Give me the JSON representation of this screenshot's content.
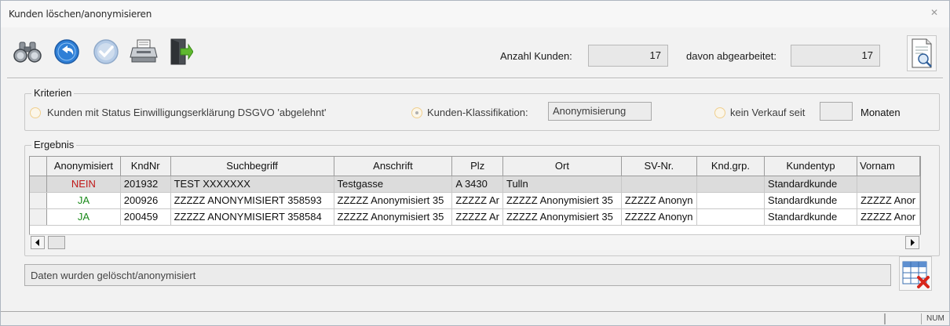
{
  "window": {
    "title": "Kunden löschen/anonymisieren"
  },
  "toolbar": {
    "buttons": [
      {
        "name": "binoculars-icon"
      },
      {
        "name": "undo-arrow-icon"
      },
      {
        "name": "checkmark-icon"
      },
      {
        "name": "printer-icon"
      },
      {
        "name": "exit-door-icon"
      }
    ],
    "count_label": "Anzahl Kunden:",
    "count_value": "17",
    "processed_label": "davon abgearbeitet:",
    "processed_value": "17",
    "preview_icon": "print-preview-icon"
  },
  "criteria": {
    "title": "Kriterien",
    "option1_label": "Kunden mit Status Einwilligungserklärung DSGVO 'abgelehnt'",
    "option2_label": "Kunden-Klassifikation:",
    "classification_value": "Anonymisierung",
    "option3_label": "kein Verkauf seit",
    "months_value": "",
    "months_unit": "Monaten",
    "selected_option": 2
  },
  "result": {
    "title": "Ergebnis",
    "columns": [
      "Anonymisiert",
      "KndNr",
      "Suchbegriff",
      "Anschrift",
      "Plz",
      "Ort",
      "SV-Nr.",
      "Knd.grp.",
      "Kundentyp",
      "Vornam"
    ],
    "rows": [
      [
        "NEIN",
        "201932",
        "TEST XXXXXXX",
        "Testgasse",
        "A 3430",
        "Tulln",
        "",
        "",
        "Standardkunde",
        ""
      ],
      [
        "JA",
        "200926",
        "ZZZZZ ANONYMISIERT 358593",
        "ZZZZZ Anonymisiert 35",
        "ZZZZZ Ar",
        "ZZZZZ Anonymisiert 35",
        "ZZZZZ Anonyn",
        "",
        "Standardkunde",
        "ZZZZZ Anor"
      ],
      [
        "JA",
        "200459",
        "ZZZZZ ANONYMISIERT 358584",
        "ZZZZZ Anonymisiert 35",
        "ZZZZZ Ar",
        "ZZZZZ Anonymisiert 35",
        "ZZZZZ Anonyn",
        "",
        "Standardkunde",
        "ZZZZZ Anor"
      ]
    ]
  },
  "status": {
    "message": "Daten wurden gelöscht/anonymisiert",
    "num_indicator": "NUM"
  },
  "colors": {
    "yes": "#1a8a1a",
    "no": "#c01818",
    "accent": "#2f7fd6"
  }
}
